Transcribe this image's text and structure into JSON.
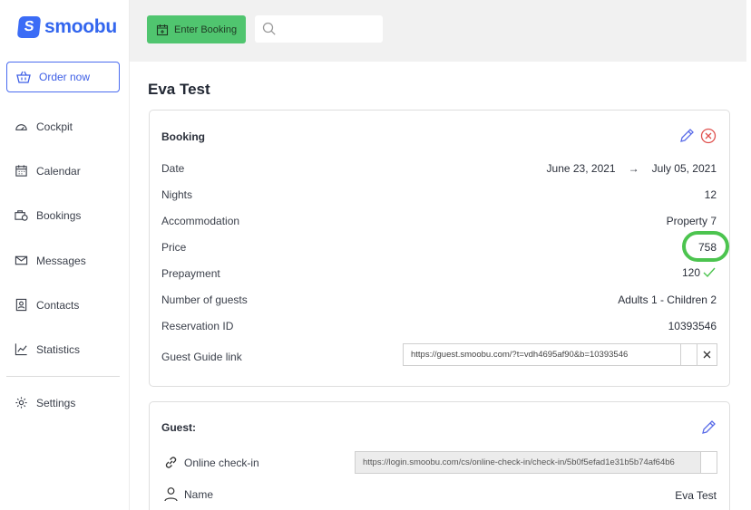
{
  "brand": {
    "name": "smoobu",
    "mark": "S",
    "color": "#3366ee"
  },
  "sidebar": {
    "order_label": "Order now",
    "items": [
      {
        "label": "Cockpit",
        "icon": "speedometer-icon"
      },
      {
        "label": "Calendar",
        "icon": "calendar-icon"
      },
      {
        "label": "Bookings",
        "icon": "bookings-icon"
      },
      {
        "label": "Messages",
        "icon": "envelope-icon"
      },
      {
        "label": "Contacts",
        "icon": "contacts-icon"
      },
      {
        "label": "Statistics",
        "icon": "chart-icon"
      }
    ],
    "settings_label": "Settings"
  },
  "topbar": {
    "enter_booking_label": "Enter Booking",
    "search_placeholder": ""
  },
  "page": {
    "title": "Eva Test"
  },
  "booking": {
    "title": "Booking",
    "date_label": "Date",
    "date_from": "June 23, 2021",
    "date_arrow": "→",
    "date_to": "July 05, 2021",
    "nights_label": "Nights",
    "nights_value": "12",
    "accommodation_label": "Accommodation",
    "accommodation_value": "Property 7",
    "price_label": "Price",
    "price_value": "758",
    "prepayment_label": "Prepayment",
    "prepayment_value": "120",
    "guests_label": "Number of guests",
    "guests_value": "Adults 1 - Children 2",
    "reservation_label": "Reservation ID",
    "reservation_value": "10393546",
    "guide_label": "Guest Guide link",
    "guide_url": "https://guest.smoobu.com/?t=vdh4695af90&b=10393546"
  },
  "guest": {
    "title": "Guest:",
    "checkin_label": "Online check-in",
    "checkin_url": "https://login.smoobu.com/cs/online-check-in/check-in/5b0f5efad1e31b5b74af64b6",
    "name_label": "Name",
    "name_value": "Eva Test"
  },
  "colors": {
    "accent_green": "#50c56f",
    "highlight": "#4cc44f",
    "link_blue": "#4a6cf0",
    "cancel_red": "#e0524f"
  }
}
